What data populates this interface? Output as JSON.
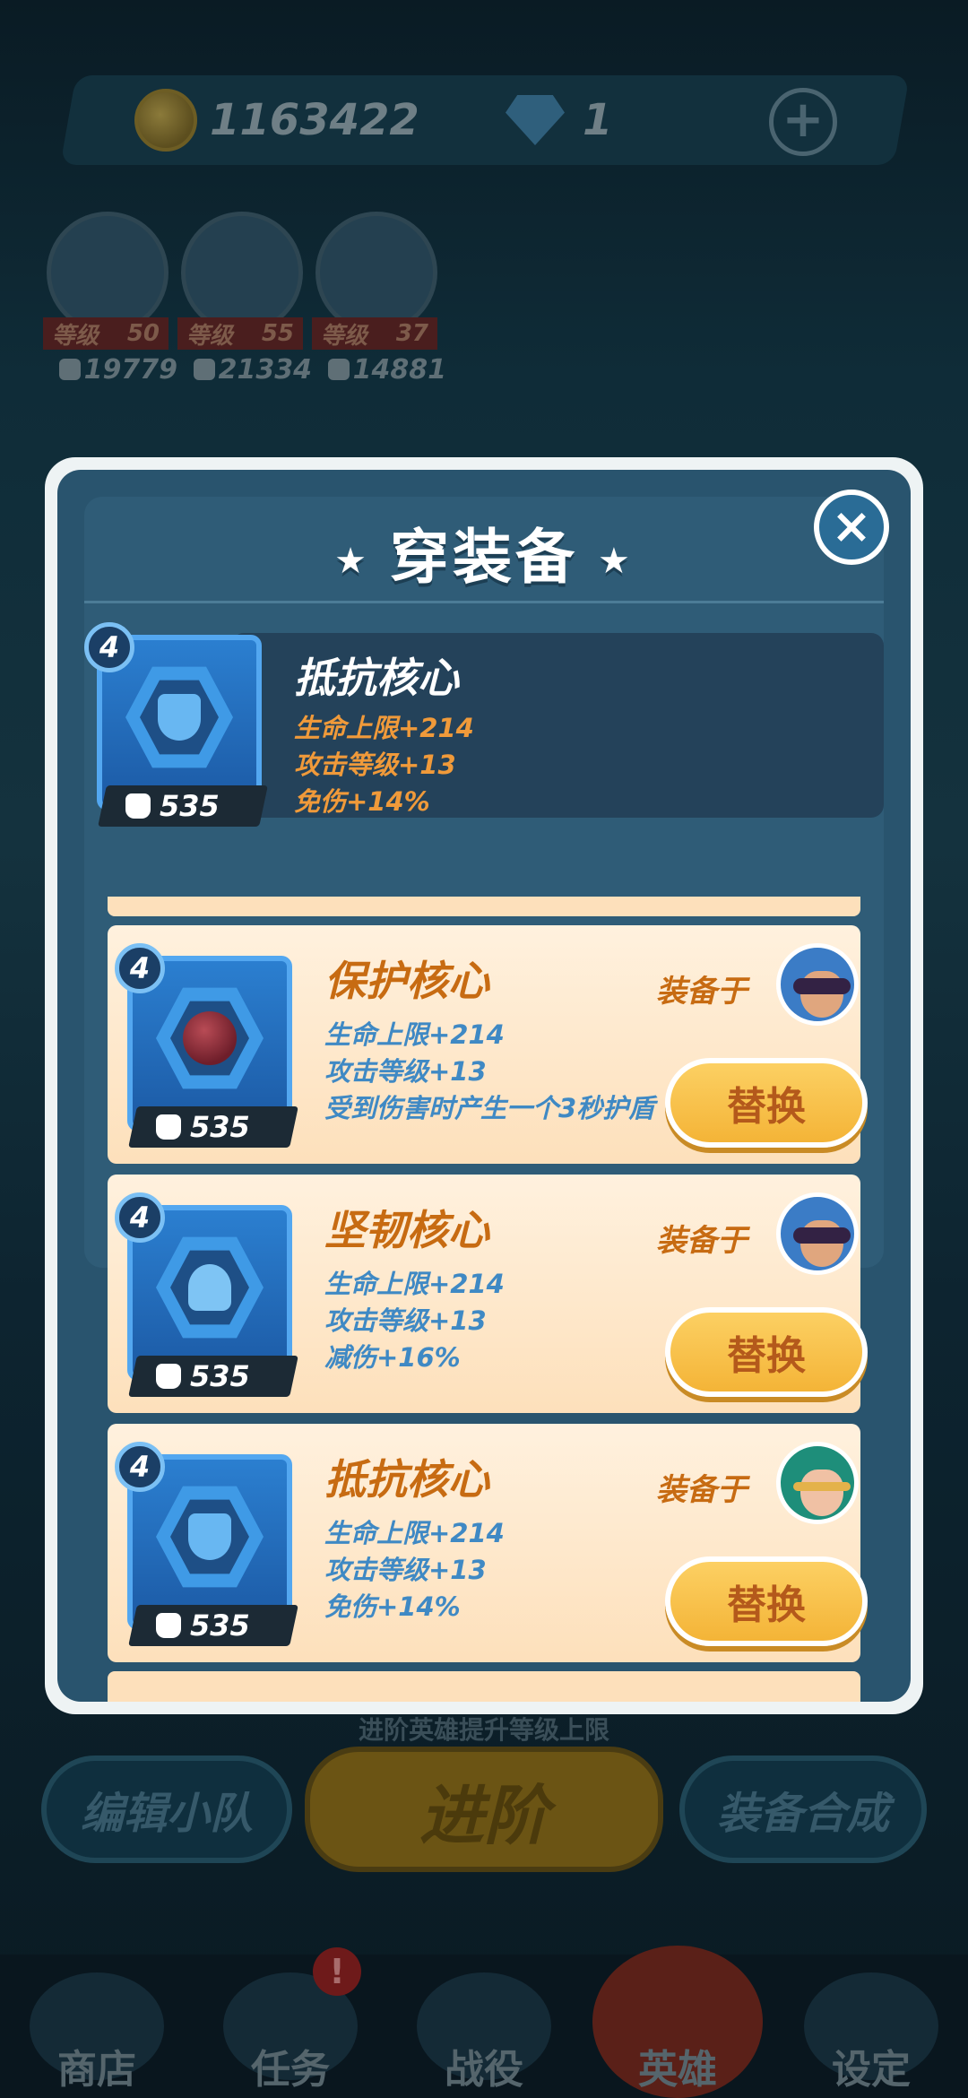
{
  "currency": {
    "coins": "1163422",
    "gems": "1",
    "coin_icon": "gold-coin-icon",
    "gem_icon": "diamond-icon",
    "add_icon": "plus-icon"
  },
  "team": [
    {
      "level_label": "等级",
      "level": "50",
      "power": "19779"
    },
    {
      "level_label": "等级",
      "level": "55",
      "power": "21334"
    },
    {
      "level_label": "等级",
      "level": "37",
      "power": "14881"
    }
  ],
  "modal": {
    "title": "穿装备",
    "close_icon": "close-x-icon",
    "selected": {
      "tier": "4",
      "name": "抵抗核心",
      "stats": [
        "生命上限+214",
        "攻击等级+13",
        "免伤+14%"
      ],
      "power": "535"
    },
    "equipped_label": "装备于",
    "replace_label": "替换",
    "items": [
      {
        "tier": "4",
        "name": "保护核心",
        "stats": [
          "生命上限+214",
          "攻击等级+13",
          "受到伤害时产生一个3秒护盾"
        ],
        "power": "535"
      },
      {
        "tier": "4",
        "name": "坚韧核心",
        "stats": [
          "生命上限+214",
          "攻击等级+13",
          "减伤+16%"
        ],
        "power": "535"
      },
      {
        "tier": "4",
        "name": "抵抗核心",
        "stats": [
          "生命上限+214",
          "攻击等级+13",
          "免伤+14%"
        ],
        "power": "535"
      }
    ]
  },
  "bottom": {
    "hint": "进阶英雄提升等级上限",
    "team_button": "编辑小队",
    "advance_button": "进阶",
    "craft_button": "装备合成"
  },
  "nav": [
    {
      "label": "商店",
      "icon": "shop-icon"
    },
    {
      "label": "任务",
      "icon": "mission-icon",
      "badge": "!"
    },
    {
      "label": "战役",
      "icon": "campaign-icon"
    },
    {
      "label": "英雄",
      "icon": "hero-icon"
    },
    {
      "label": "设定",
      "icon": "settings-gear-icon"
    }
  ],
  "colors": {
    "accent_orange": "#c76b12",
    "stat_blue": "#3f89c4",
    "button_yellow": "#f4b437",
    "modal_blue": "#29546e"
  }
}
